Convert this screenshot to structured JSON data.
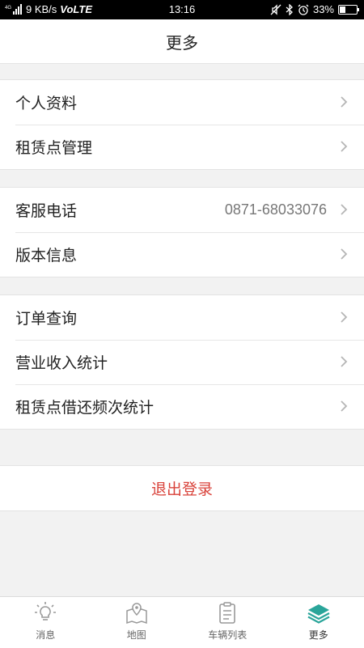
{
  "status_bar": {
    "network_speed": "9 KB/s",
    "carrier_tech": "VoLTE",
    "signal_prefix": "4G",
    "time": "13:16",
    "battery_percent": "33%",
    "battery_level": 0.33
  },
  "header": {
    "title": "更多"
  },
  "groups": [
    {
      "items": [
        {
          "label": "个人资料"
        },
        {
          "label": "租赁点管理"
        }
      ]
    },
    {
      "items": [
        {
          "label": "客服电话",
          "value": "0871-68033076"
        },
        {
          "label": "版本信息"
        }
      ]
    },
    {
      "items": [
        {
          "label": "订单查询"
        },
        {
          "label": "营业收入统计"
        },
        {
          "label": "租赁点借还频次统计"
        }
      ]
    }
  ],
  "logout": {
    "label": "退出登录",
    "color": "#d9433b"
  },
  "tabs": [
    {
      "label": "消息",
      "icon": "lightbulb-icon"
    },
    {
      "label": "地图",
      "icon": "map-pin-icon"
    },
    {
      "label": "车辆列表",
      "icon": "clipboard-icon"
    },
    {
      "label": "更多",
      "icon": "layers-icon",
      "active": true,
      "color": "#2aa59a"
    }
  ]
}
